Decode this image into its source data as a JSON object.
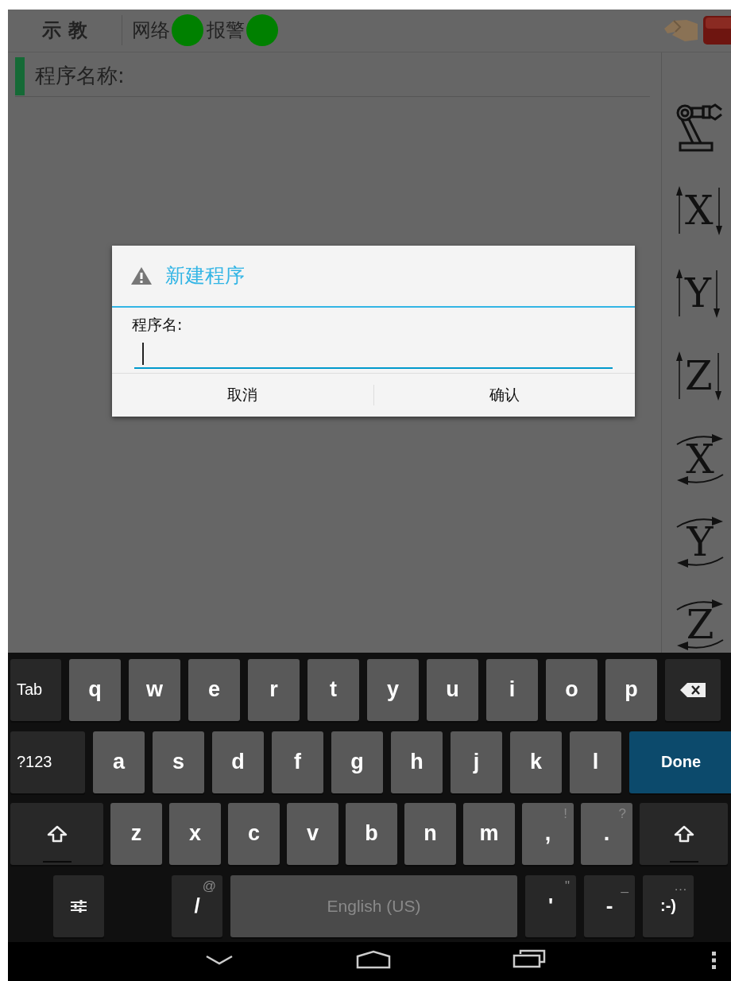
{
  "top_bar": {
    "title": "示 教",
    "indicators": [
      {
        "label": "网络",
        "color": "#008000"
      },
      {
        "label": "报警",
        "color": "#008000"
      }
    ]
  },
  "program_name": {
    "label": "程序名称:"
  },
  "tools": [
    {
      "kind": "robot"
    },
    {
      "kind": "linear",
      "axis": "X"
    },
    {
      "kind": "linear",
      "axis": "Y"
    },
    {
      "kind": "linear",
      "axis": "Z"
    },
    {
      "kind": "rotate",
      "axis": "X"
    },
    {
      "kind": "rotate",
      "axis": "Y"
    },
    {
      "kind": "rotate",
      "axis": "Z"
    }
  ],
  "dialog": {
    "title": "新建程序",
    "field_label": "程序名:",
    "focused": true,
    "buttons": [
      "取消",
      "确认"
    ]
  },
  "keyboard": {
    "rows": [
      {
        "keys": [
          {
            "kind": "function",
            "label": "Tab"
          },
          {
            "kind": "letter",
            "label": "q"
          },
          {
            "kind": "letter",
            "label": "w"
          },
          {
            "kind": "letter",
            "label": "e"
          },
          {
            "kind": "letter",
            "label": "r"
          },
          {
            "kind": "letter",
            "label": "t"
          },
          {
            "kind": "letter",
            "label": "y"
          },
          {
            "kind": "letter",
            "label": "u"
          },
          {
            "kind": "letter",
            "label": "i"
          },
          {
            "kind": "letter",
            "label": "o"
          },
          {
            "kind": "letter",
            "label": "p"
          },
          {
            "kind": "backspace"
          }
        ]
      },
      {
        "keys": [
          {
            "kind": "function",
            "label": "?123"
          },
          {
            "kind": "letter",
            "label": "a"
          },
          {
            "kind": "letter",
            "label": "s"
          },
          {
            "kind": "letter",
            "label": "d"
          },
          {
            "kind": "letter",
            "label": "f"
          },
          {
            "kind": "letter",
            "label": "g"
          },
          {
            "kind": "letter",
            "label": "h"
          },
          {
            "kind": "letter",
            "label": "j"
          },
          {
            "kind": "letter",
            "label": "k"
          },
          {
            "kind": "letter",
            "label": "l"
          },
          {
            "kind": "done",
            "label": "Done"
          }
        ]
      },
      {
        "keys": [
          {
            "kind": "shift"
          },
          {
            "kind": "letter",
            "label": "z"
          },
          {
            "kind": "letter",
            "label": "x"
          },
          {
            "kind": "letter",
            "label": "c"
          },
          {
            "kind": "letter",
            "label": "v"
          },
          {
            "kind": "letter",
            "label": "b"
          },
          {
            "kind": "letter",
            "label": "n"
          },
          {
            "kind": "letter",
            "label": "m"
          },
          {
            "kind": "letter",
            "label": ",",
            "hint": "!"
          },
          {
            "kind": "letter",
            "label": ".",
            "hint": "?"
          },
          {
            "kind": "shift"
          }
        ]
      },
      {
        "keys": [
          {
            "kind": "settings"
          },
          {
            "kind": "symbol",
            "label": "/",
            "hint": "@"
          },
          {
            "kind": "space",
            "label": "English (US)"
          },
          {
            "kind": "symbol",
            "label": "'",
            "hint": "\""
          },
          {
            "kind": "symbol",
            "label": "-",
            "hint": "_"
          },
          {
            "kind": "symbol",
            "label": ":-)",
            "hint": "…"
          }
        ]
      }
    ]
  }
}
